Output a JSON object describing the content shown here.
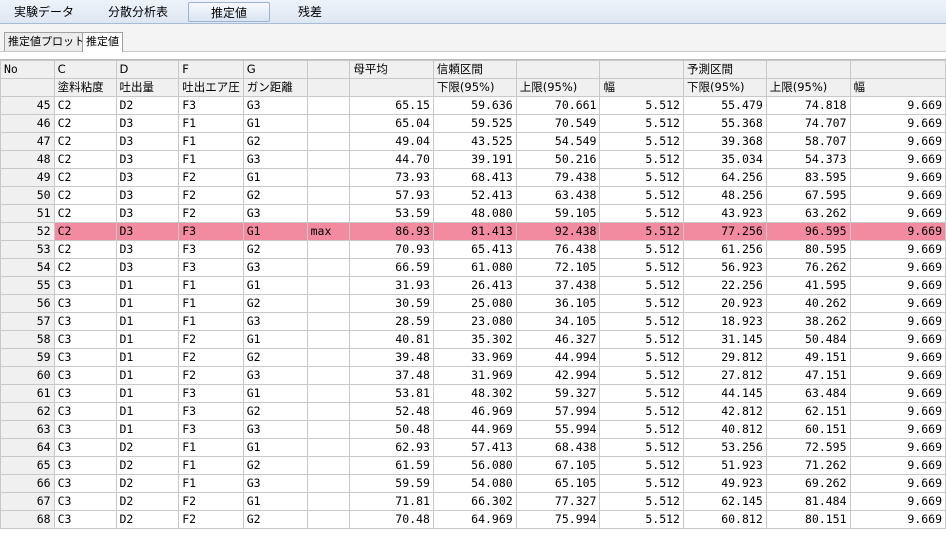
{
  "top_tabs": [
    "実験データ",
    "分散分析表",
    "推定値",
    "残差"
  ],
  "sub_tabs": [
    "推定値プロット",
    "推定値"
  ],
  "header": {
    "row1": [
      "No",
      "C",
      "D",
      "F",
      "G",
      "",
      "母平均",
      "信頼区間",
      "",
      "",
      "予測区間",
      "",
      ""
    ],
    "row2": [
      "",
      "塗料粘度",
      "吐出量",
      "吐出エア圧",
      "ガン距離",
      "",
      "",
      "下限(95%)",
      "上限(95%)",
      "幅",
      "下限(95%)",
      "上限(95%)",
      "幅"
    ]
  },
  "rows": [
    [
      "45",
      "C2",
      "D2",
      "F3",
      "G3",
      "",
      "65.15",
      "59.636",
      "70.661",
      "5.512",
      "55.479",
      "74.818",
      "9.669"
    ],
    [
      "46",
      "C2",
      "D3",
      "F1",
      "G1",
      "",
      "65.04",
      "59.525",
      "70.549",
      "5.512",
      "55.368",
      "74.707",
      "9.669"
    ],
    [
      "47",
      "C2",
      "D3",
      "F1",
      "G2",
      "",
      "49.04",
      "43.525",
      "54.549",
      "5.512",
      "39.368",
      "58.707",
      "9.669"
    ],
    [
      "48",
      "C2",
      "D3",
      "F1",
      "G3",
      "",
      "44.70",
      "39.191",
      "50.216",
      "5.512",
      "35.034",
      "54.373",
      "9.669"
    ],
    [
      "49",
      "C2",
      "D3",
      "F2",
      "G1",
      "",
      "73.93",
      "68.413",
      "79.438",
      "5.512",
      "64.256",
      "83.595",
      "9.669"
    ],
    [
      "50",
      "C2",
      "D3",
      "F2",
      "G2",
      "",
      "57.93",
      "52.413",
      "63.438",
      "5.512",
      "48.256",
      "67.595",
      "9.669"
    ],
    [
      "51",
      "C2",
      "D3",
      "F2",
      "G3",
      "",
      "53.59",
      "48.080",
      "59.105",
      "5.512",
      "43.923",
      "63.262",
      "9.669"
    ],
    [
      "52",
      "C2",
      "D3",
      "F3",
      "G1",
      "max",
      "86.93",
      "81.413",
      "92.438",
      "5.512",
      "77.256",
      "96.595",
      "9.669"
    ],
    [
      "53",
      "C2",
      "D3",
      "F3",
      "G2",
      "",
      "70.93",
      "65.413",
      "76.438",
      "5.512",
      "61.256",
      "80.595",
      "9.669"
    ],
    [
      "54",
      "C2",
      "D3",
      "F3",
      "G3",
      "",
      "66.59",
      "61.080",
      "72.105",
      "5.512",
      "56.923",
      "76.262",
      "9.669"
    ],
    [
      "55",
      "C3",
      "D1",
      "F1",
      "G1",
      "",
      "31.93",
      "26.413",
      "37.438",
      "5.512",
      "22.256",
      "41.595",
      "9.669"
    ],
    [
      "56",
      "C3",
      "D1",
      "F1",
      "G2",
      "",
      "30.59",
      "25.080",
      "36.105",
      "5.512",
      "20.923",
      "40.262",
      "9.669"
    ],
    [
      "57",
      "C3",
      "D1",
      "F1",
      "G3",
      "",
      "28.59",
      "23.080",
      "34.105",
      "5.512",
      "18.923",
      "38.262",
      "9.669"
    ],
    [
      "58",
      "C3",
      "D1",
      "F2",
      "G1",
      "",
      "40.81",
      "35.302",
      "46.327",
      "5.512",
      "31.145",
      "50.484",
      "9.669"
    ],
    [
      "59",
      "C3",
      "D1",
      "F2",
      "G2",
      "",
      "39.48",
      "33.969",
      "44.994",
      "5.512",
      "29.812",
      "49.151",
      "9.669"
    ],
    [
      "60",
      "C3",
      "D1",
      "F2",
      "G3",
      "",
      "37.48",
      "31.969",
      "42.994",
      "5.512",
      "27.812",
      "47.151",
      "9.669"
    ],
    [
      "61",
      "C3",
      "D1",
      "F3",
      "G1",
      "",
      "53.81",
      "48.302",
      "59.327",
      "5.512",
      "44.145",
      "63.484",
      "9.669"
    ],
    [
      "62",
      "C3",
      "D1",
      "F3",
      "G2",
      "",
      "52.48",
      "46.969",
      "57.994",
      "5.512",
      "42.812",
      "62.151",
      "9.669"
    ],
    [
      "63",
      "C3",
      "D1",
      "F3",
      "G3",
      "",
      "50.48",
      "44.969",
      "55.994",
      "5.512",
      "40.812",
      "60.151",
      "9.669"
    ],
    [
      "64",
      "C3",
      "D2",
      "F1",
      "G1",
      "",
      "62.93",
      "57.413",
      "68.438",
      "5.512",
      "53.256",
      "72.595",
      "9.669"
    ],
    [
      "65",
      "C3",
      "D2",
      "F1",
      "G2",
      "",
      "61.59",
      "56.080",
      "67.105",
      "5.512",
      "51.923",
      "71.262",
      "9.669"
    ],
    [
      "66",
      "C3",
      "D2",
      "F1",
      "G3",
      "",
      "59.59",
      "54.080",
      "65.105",
      "5.512",
      "49.923",
      "69.262",
      "9.669"
    ],
    [
      "67",
      "C3",
      "D2",
      "F2",
      "G1",
      "",
      "71.81",
      "66.302",
      "77.327",
      "5.512",
      "62.145",
      "81.484",
      "9.669"
    ],
    [
      "68",
      "C3",
      "D2",
      "F2",
      "G2",
      "",
      "70.48",
      "64.969",
      "75.994",
      "5.512",
      "60.812",
      "80.151",
      "9.669"
    ]
  ],
  "highlight_row_no": "52",
  "colors": {
    "highlight": "#f28aa0",
    "header_bg": "#f0f0f0",
    "topbar": "#dde7f3"
  }
}
